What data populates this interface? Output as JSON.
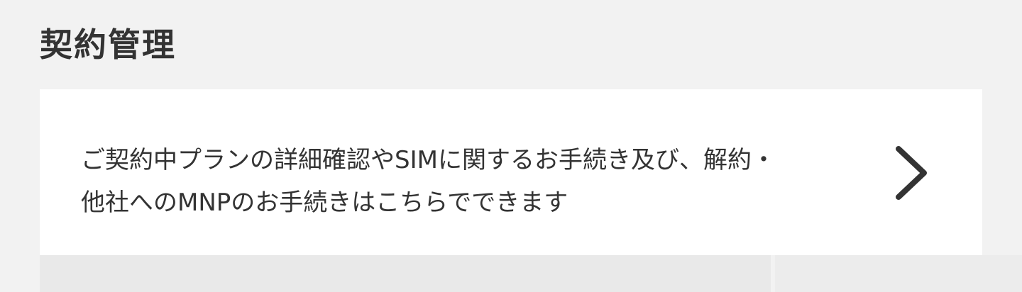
{
  "section": {
    "title": "契約管理"
  },
  "card": {
    "lines": [
      "ご契約中プランの詳細確認やSIMに関するお手続き及び、解約・",
      "他社へのMNPのお手続きはこちらでできます"
    ],
    "chevron_icon": "chevron-right-icon"
  },
  "colors": {
    "background": "#f2f2f2",
    "card": "#ffffff",
    "text": "#333333",
    "chevron": "#333333"
  }
}
